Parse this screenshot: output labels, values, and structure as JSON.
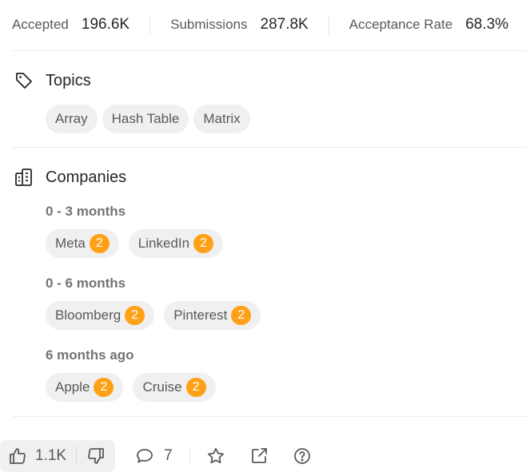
{
  "stats": {
    "accepted_label": "Accepted",
    "accepted_value": "196.6K",
    "submissions_label": "Submissions",
    "submissions_value": "287.8K",
    "acceptance_label": "Acceptance Rate",
    "acceptance_value": "68.3%"
  },
  "topics": {
    "title": "Topics",
    "icon": "tag-icon",
    "tags": [
      "Array",
      "Hash Table",
      "Matrix"
    ]
  },
  "companies": {
    "title": "Companies",
    "icon": "building-icon",
    "groups": [
      {
        "period": "0 - 3 months",
        "items": [
          {
            "name": "Meta",
            "count": "2"
          },
          {
            "name": "LinkedIn",
            "count": "2"
          }
        ]
      },
      {
        "period": "0 - 6 months",
        "items": [
          {
            "name": "Bloomberg",
            "count": "2"
          },
          {
            "name": "Pinterest",
            "count": "2"
          }
        ]
      },
      {
        "period": "6 months ago",
        "items": [
          {
            "name": "Apple",
            "count": "2"
          },
          {
            "name": "Cruise",
            "count": "2"
          }
        ]
      }
    ]
  },
  "footer": {
    "likes": "1.1K",
    "comments": "7",
    "icons": [
      "thumbs-up-icon",
      "thumbs-down-icon",
      "comment-icon",
      "star-icon",
      "share-icon",
      "help-icon"
    ]
  },
  "colors": {
    "accent_badge": "#ffa116",
    "chip_bg": "#f0f0f0",
    "divider": "#ebebeb"
  }
}
